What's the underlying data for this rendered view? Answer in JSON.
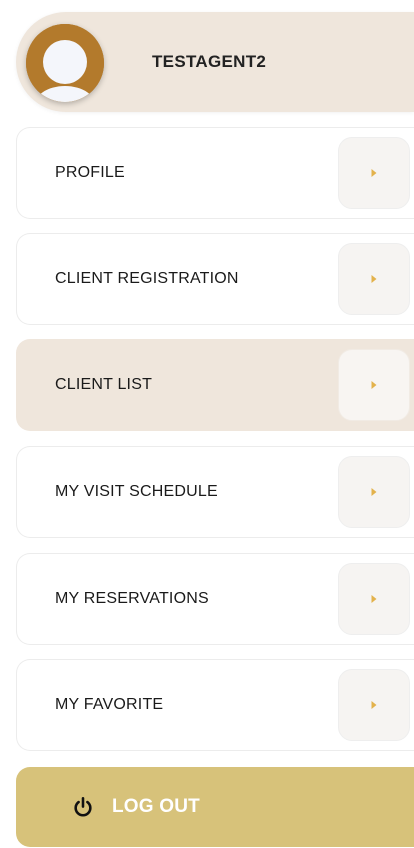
{
  "profile": {
    "username": "TESTAGENT2",
    "avatar_icon": "user-avatar-icon",
    "avatar_color": "#b37a2c"
  },
  "menu": {
    "items": [
      {
        "label": "PROFILE",
        "icon": "chevron-right-icon",
        "active": false
      },
      {
        "label": "CLIENT REGISTRATION",
        "icon": "chevron-right-icon",
        "active": false
      },
      {
        "label": "CLIENT LIST",
        "icon": "chevron-right-icon",
        "active": true
      },
      {
        "label": "MY VISIT SCHEDULE",
        "icon": "chevron-right-icon",
        "active": false
      },
      {
        "label": "MY RESERVATIONS",
        "icon": "chevron-right-icon",
        "active": false
      },
      {
        "label": "MY FAVORITE",
        "icon": "chevron-right-icon",
        "active": false
      }
    ]
  },
  "logout": {
    "label": "LOG OUT",
    "icon": "power-icon",
    "color": "#d7c27a"
  },
  "colors": {
    "active_bg": "#efe6dc",
    "accent_arrow": "#e3b24c"
  }
}
